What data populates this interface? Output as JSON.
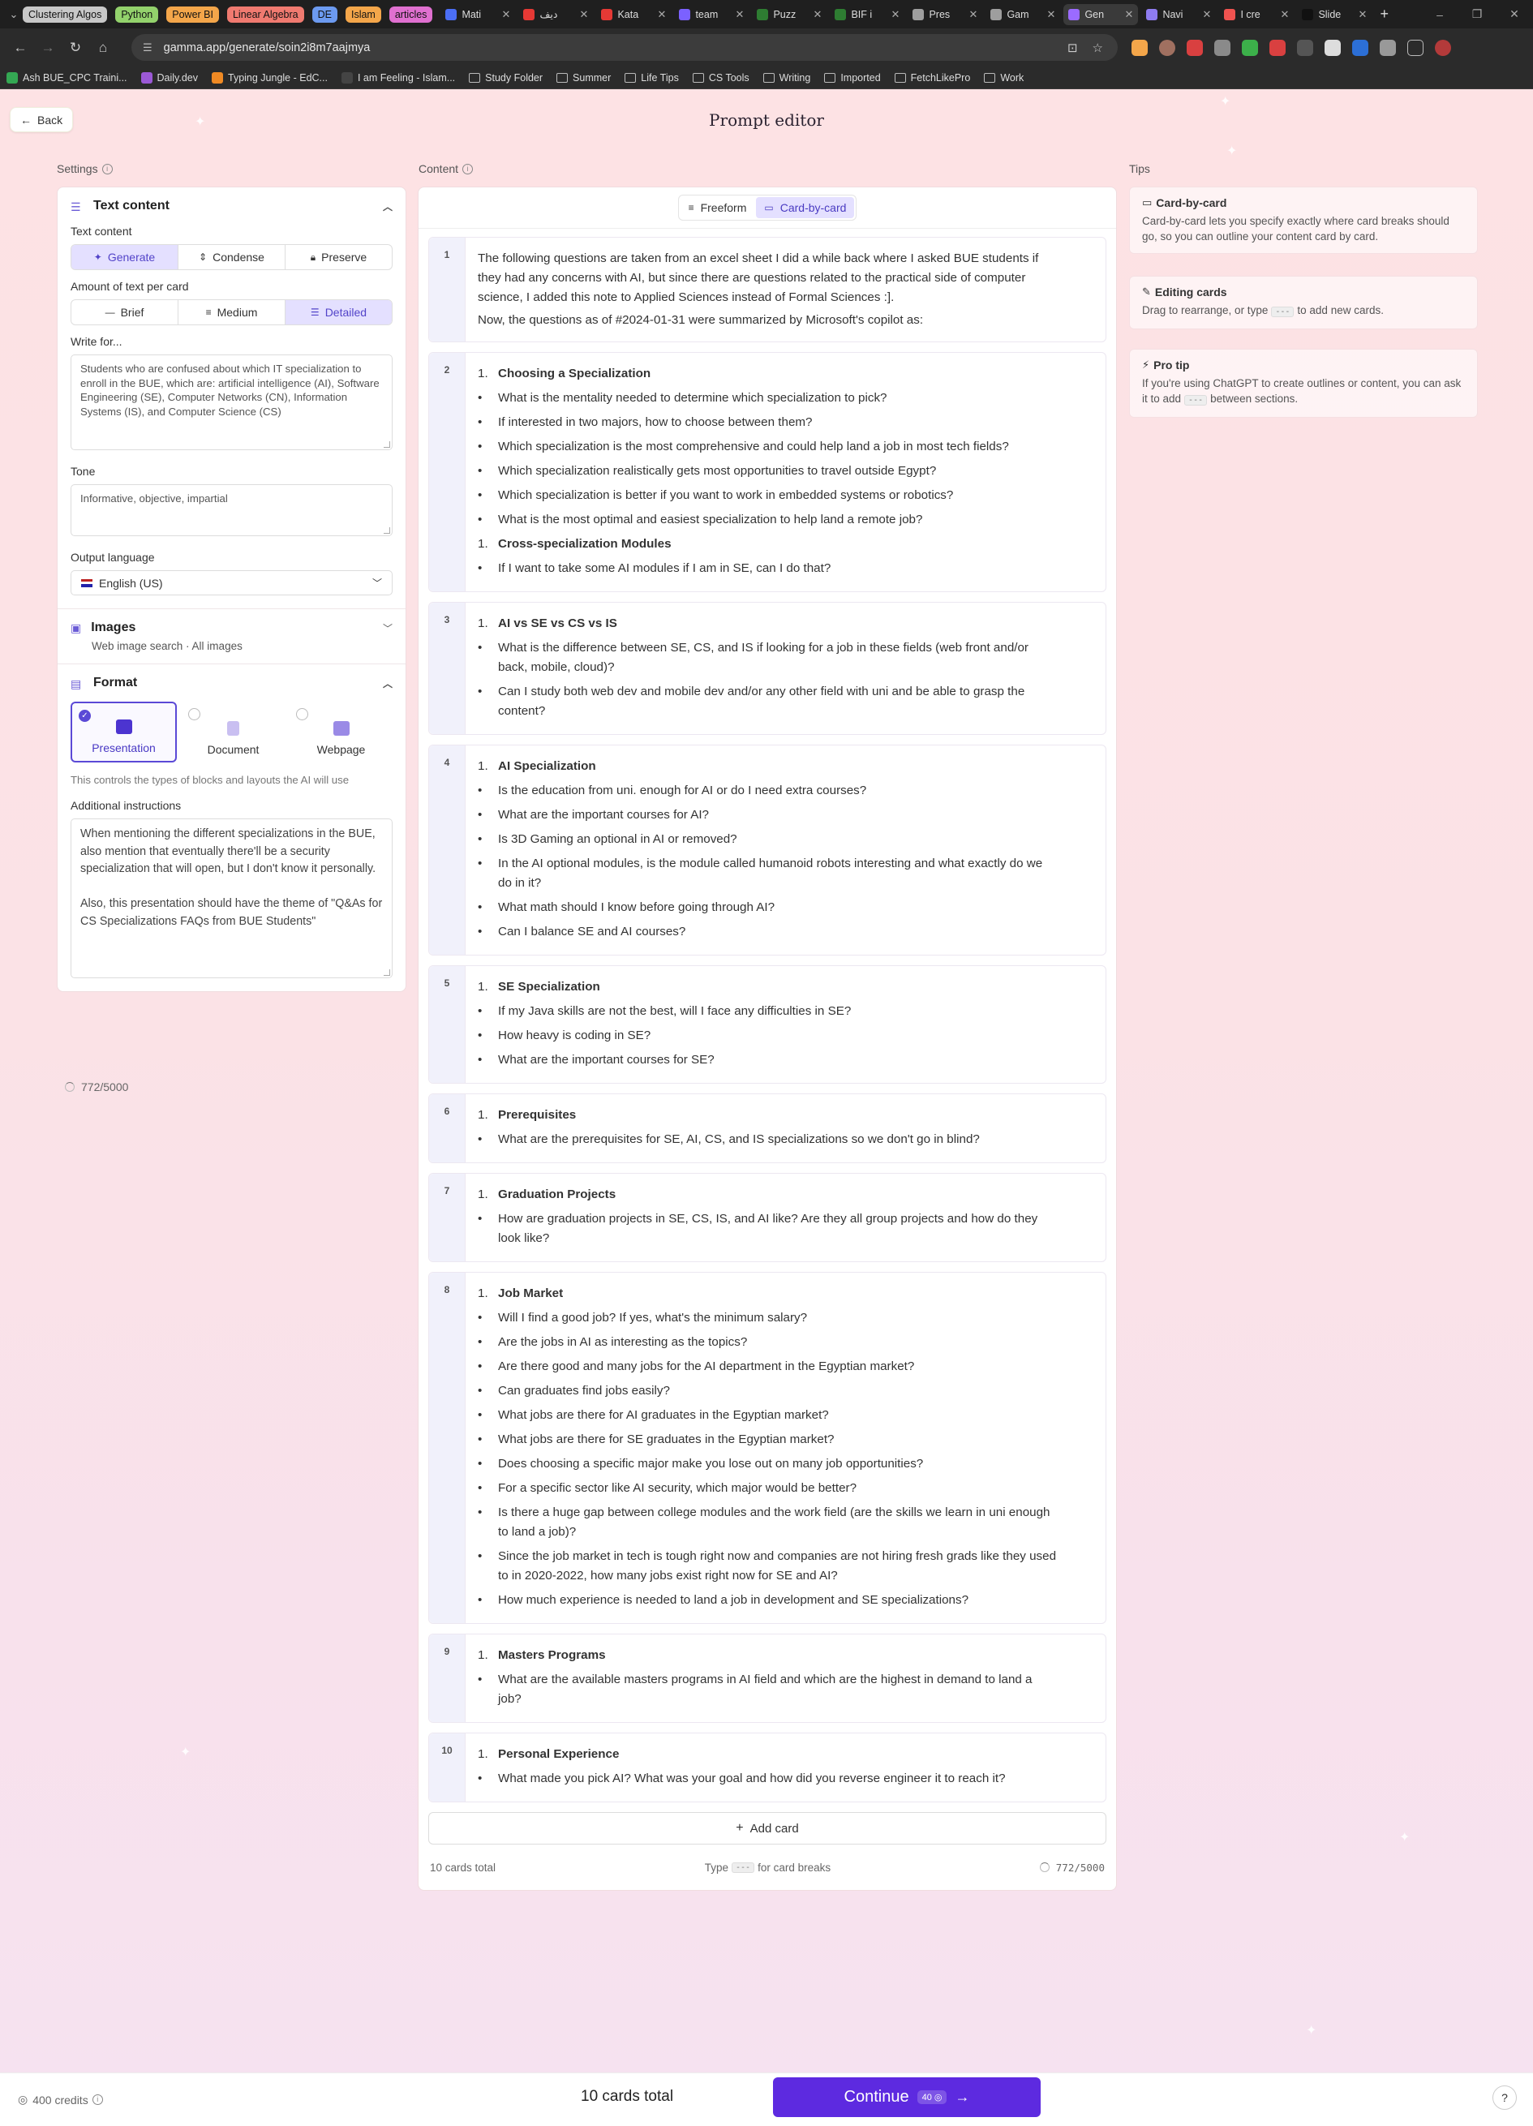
{
  "browser": {
    "tab_groups": [
      {
        "label": "Clustering Algos",
        "color": "#c8c8c8"
      },
      {
        "label": "Python",
        "color": "#93d26c"
      },
      {
        "label": "Power BI",
        "color": "#f4a64a"
      },
      {
        "label": "Linear Algebra",
        "color": "#f07a70"
      },
      {
        "label": "DE",
        "color": "#6c9af0"
      },
      {
        "label": "Islam",
        "color": "#f4a64a"
      },
      {
        "label": "articles",
        "color": "#e070d0"
      }
    ],
    "tabs": [
      {
        "title": "Mati",
        "fav": "#4b6ef5",
        "active": false
      },
      {
        "title": "ديف",
        "fav": "#e53935",
        "active": false
      },
      {
        "title": "Kata",
        "fav": "#e53935",
        "active": false
      },
      {
        "title": "team",
        "fav": "#7b61ff",
        "active": false
      },
      {
        "title": "Puzz",
        "fav": "#2e7d32",
        "active": false
      },
      {
        "title": "BIF i",
        "fav": "#2e7d32",
        "active": false
      },
      {
        "title": "Pres",
        "fav": "#9e9e9e",
        "active": false
      },
      {
        "title": "Gam",
        "fav": "#9e9e9e",
        "active": false
      },
      {
        "title": "Gen",
        "fav": "#9b6bff",
        "active": true
      },
      {
        "title": "Navi",
        "fav": "#8e7cf0",
        "active": false
      },
      {
        "title": "I cre",
        "fav": "#ef5350",
        "active": false
      },
      {
        "title": "Slide",
        "fav": "#111111",
        "active": false
      }
    ],
    "url": "gamma.app/generate/soin2i8m7aajmya",
    "bookmarks": [
      {
        "label": "Ash BUE_CPC Traini...",
        "fav": "#34a853"
      },
      {
        "label": "Daily.dev",
        "fav": "#9b59d6"
      },
      {
        "label": "Typing Jungle - EdC...",
        "fav": "#f08a24"
      },
      {
        "label": "I am Feeling - Islam...",
        "fav": "#444444"
      },
      {
        "label": "Study Folder",
        "fav": ""
      },
      {
        "label": "Summer",
        "fav": ""
      },
      {
        "label": "Life Tips",
        "fav": ""
      },
      {
        "label": "CS Tools",
        "fav": ""
      },
      {
        "label": "Writing",
        "fav": ""
      },
      {
        "label": "Imported",
        "fav": ""
      },
      {
        "label": "FetchLikePro",
        "fav": ""
      },
      {
        "label": "Work",
        "fav": ""
      }
    ]
  },
  "page": {
    "back_label": "Back",
    "title": "Prompt editor",
    "settings_label": "Settings",
    "content_label": "Content",
    "tips_label": "Tips"
  },
  "settings": {
    "text_content_header": "Text content",
    "text_content_label": "Text content",
    "text_content_options": [
      "Generate",
      "Condense",
      "Preserve"
    ],
    "text_content_selected": "Generate",
    "amount_label": "Amount of text per card",
    "amount_options": [
      "Brief",
      "Medium",
      "Detailed"
    ],
    "amount_selected": "Detailed",
    "write_for_label": "Write for...",
    "write_for_value": "Students who are confused about which IT specialization to enroll in the BUE, which are: artificial intelligence (AI), Software Engineering (SE), Computer Networks (CN), Information Systems (IS), and Computer Science (CS)",
    "tone_label": "Tone",
    "tone_value": "Informative, objective, impartial",
    "output_language_label": "Output language",
    "output_language_value": "English (US)",
    "images_header": "Images",
    "images_sub": "Web image search · All images",
    "format_header": "Format",
    "format_options": [
      "Presentation",
      "Document",
      "Webpage"
    ],
    "format_selected": "Presentation",
    "format_hint": "This controls the types of blocks and layouts the AI will use",
    "additional_label": "Additional instructions",
    "additional_value": "When mentioning the different specializations in the BUE, also mention that eventually there'll be a security specialization that will open, but I don't know it personally.\n\nAlso, this presentation should have the theme of \"Q&As for CS Specializations FAQs from BUE Students\"",
    "char_count": "772/5000"
  },
  "content": {
    "modes": [
      "Freeform",
      "Card-by-card"
    ],
    "mode_selected": "Card-by-card",
    "cards": [
      {
        "num": "1",
        "paragraphs": [
          "The following questions are taken from an excel sheet I did a while back where I asked BUE students if they had any concerns with AI, but since there are questions related to the practical side of computer science, I added this note to Applied Sciences instead of Formal Sciences :].",
          "Now, the questions as of #2024-01-31 were summarized by Microsoft's copilot as:"
        ],
        "sections": []
      },
      {
        "num": "2",
        "paragraphs": [],
        "sections": [
          {
            "heading": "Choosing a Specialization",
            "items": [
              "What is the mentality needed to determine which specialization to pick?",
              "If interested in two majors, how to choose between them?",
              "Which specialization is the most comprehensive and could help land a job in most tech fields?",
              "Which specialization realistically gets most opportunities to travel outside Egypt?",
              "Which specialization is better if you want to work in embedded systems or robotics?",
              "What is the most optimal and easiest specialization to help land a remote job?"
            ]
          },
          {
            "heading": "Cross-specialization Modules",
            "items": [
              "If I want to take some AI modules if I am in SE, can I do that?"
            ]
          }
        ]
      },
      {
        "num": "3",
        "paragraphs": [],
        "sections": [
          {
            "heading": "AI vs SE vs CS vs IS",
            "items": [
              "What is the difference between SE, CS, and IS if looking for a job in these fields (web front and/or back, mobile, cloud)?",
              "Can I study both web dev and mobile dev and/or any other field with uni and be able to grasp the content?"
            ]
          }
        ]
      },
      {
        "num": "4",
        "paragraphs": [],
        "sections": [
          {
            "heading": "AI Specialization",
            "items": [
              "Is the education from uni. enough for AI or do I need extra courses?",
              "What are the important courses for AI?",
              "Is 3D Gaming an optional in AI or removed?",
              "In the AI optional modules, is the module called humanoid robots interesting and what exactly do we do in it?",
              "What math should I know before going through AI?",
              "Can I balance SE and AI courses?"
            ]
          }
        ]
      },
      {
        "num": "5",
        "paragraphs": [],
        "sections": [
          {
            "heading": "SE Specialization",
            "items": [
              "If my Java skills are not the best, will I face any difficulties in SE?",
              "How heavy is coding in SE?",
              "What are the important courses for SE?"
            ]
          }
        ]
      },
      {
        "num": "6",
        "paragraphs": [],
        "sections": [
          {
            "heading": "Prerequisites",
            "items": [
              "What are the prerequisites for SE, AI, CS, and IS specializations so we don't go in blind?"
            ]
          }
        ]
      },
      {
        "num": "7",
        "paragraphs": [],
        "sections": [
          {
            "heading": "Graduation Projects",
            "items": [
              "How are graduation projects in SE, CS, IS, and AI like? Are they all group projects and how do they look like?"
            ]
          }
        ]
      },
      {
        "num": "8",
        "paragraphs": [],
        "sections": [
          {
            "heading": "Job Market",
            "items": [
              "Will I find a good job? If yes, what's the minimum salary?",
              "Are the jobs in AI as interesting as the topics?",
              "Are there good and many jobs for the AI department in the Egyptian market?",
              "Can graduates find jobs easily?",
              "What jobs are there for AI graduates in the Egyptian market?",
              "What jobs are there for SE graduates in the Egyptian market?",
              "Does choosing a specific major make you lose out on many job opportunities?",
              "For a specific sector like AI security, which major would be better?",
              "Is there a huge gap between college modules and the work field (are the skills we learn in uni enough to land a job)?",
              "Since the job market in tech is tough right now and companies are not hiring fresh grads like they used to in 2020-2022, how many jobs exist right now for SE and AI?",
              "How much experience is needed to land a job in development and SE specializations?"
            ]
          }
        ]
      },
      {
        "num": "9",
        "paragraphs": [],
        "sections": [
          {
            "heading": "Masters Programs",
            "items": [
              "What are the available masters programs in AI field and which are the highest in demand to land a job?"
            ]
          }
        ]
      },
      {
        "num": "10",
        "paragraphs": [],
        "sections": [
          {
            "heading": "Personal Experience",
            "items": [
              "What made you pick AI? What was your goal and how did you reverse engineer it to reach it?"
            ]
          }
        ]
      }
    ],
    "list_number": "1.",
    "bullet": "•",
    "add_card_label": "Add card",
    "cards_total": "10 cards total",
    "hint_pre": "Type",
    "hint_kbd": "---",
    "hint_post": "for card breaks",
    "char_count": "772/5000"
  },
  "tips": [
    {
      "title": "Card-by-card",
      "icon": "card-icon",
      "text": "Card-by-card lets you specify exactly where card breaks should go, so you can outline your content card by card."
    },
    {
      "title": "Editing cards",
      "icon": "edit-icon",
      "text_pre": "Drag to rearrange, or type",
      "kbd": "---",
      "text_post": "to add new cards."
    },
    {
      "title": "Pro tip",
      "icon": "bolt-icon",
      "text_pre": "If you're using ChatGPT to create outlines or content, you can ask it to add",
      "kbd": "---",
      "text_post": "between sections."
    }
  ],
  "bottom": {
    "credits": "400 credits",
    "cards_total": "10 cards total",
    "continue_label": "Continue",
    "continue_cost": "40",
    "accent": "#5d2ae0"
  }
}
